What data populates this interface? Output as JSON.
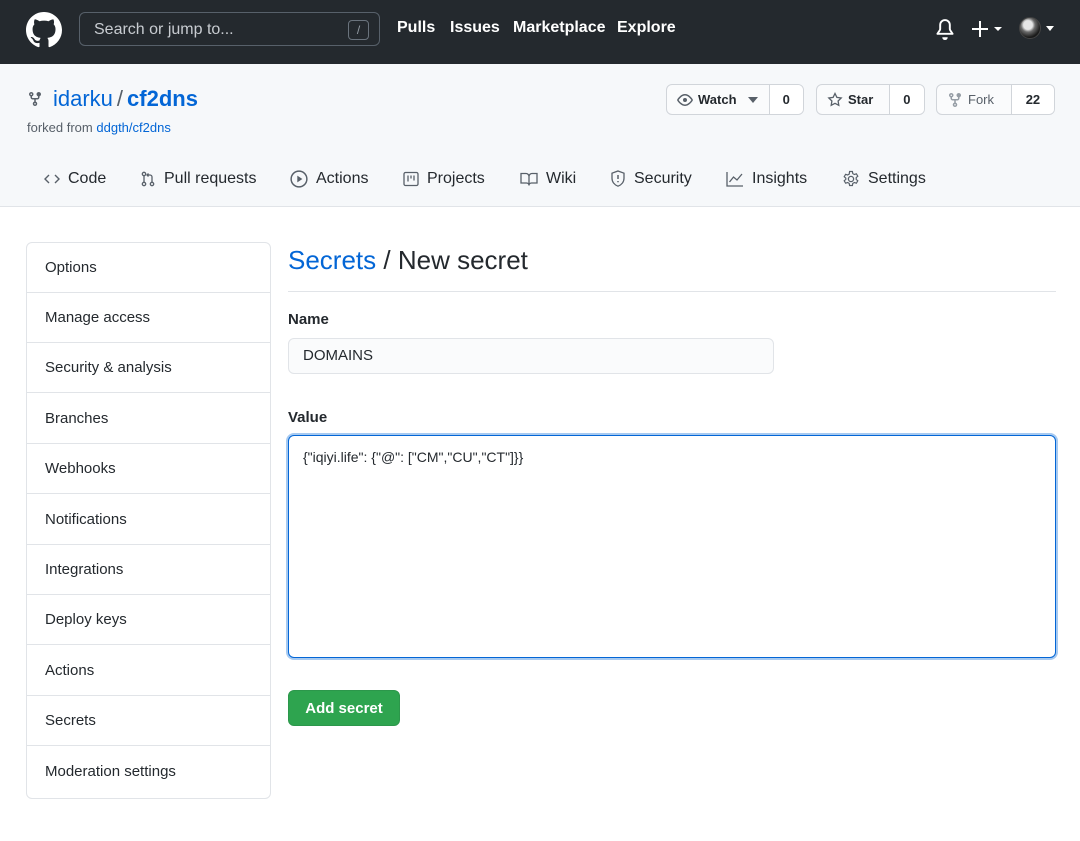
{
  "header": {
    "search_placeholder": "Search or jump to...",
    "search_shortcut": "/",
    "nav": [
      "Pulls",
      "Issues",
      "Marketplace",
      "Explore"
    ]
  },
  "repo": {
    "owner": "idarku",
    "separator": "/",
    "name": "cf2dns",
    "forked_from_label": "forked from",
    "forked_from_link": "ddgth/cf2dns",
    "watch_label": "Watch",
    "watch_count": "0",
    "star_label": "Star",
    "star_count": "0",
    "fork_label": "Fork",
    "fork_count": "22"
  },
  "tabs": [
    "Code",
    "Pull requests",
    "Actions",
    "Projects",
    "Wiki",
    "Security",
    "Insights",
    "Settings"
  ],
  "sidebar": {
    "items": [
      "Options",
      "Manage access",
      "Security & analysis",
      "Branches",
      "Webhooks",
      "Notifications",
      "Integrations",
      "Deploy keys",
      "Actions",
      "Secrets",
      "Moderation settings"
    ]
  },
  "form": {
    "breadcrumb_link": "Secrets",
    "breadcrumb_sep": "/",
    "title": "New secret",
    "name_label": "Name",
    "name_value": "DOMAINS",
    "value_label": "Value",
    "value_text": "{\"iqiyi.life\": {\"@\": [\"CM\",\"CU\",\"CT\"]}}",
    "submit_label": "Add secret"
  },
  "colors": {
    "header_bg": "#24292e",
    "link": "#0366d6",
    "primary_button": "#2ea44f"
  }
}
